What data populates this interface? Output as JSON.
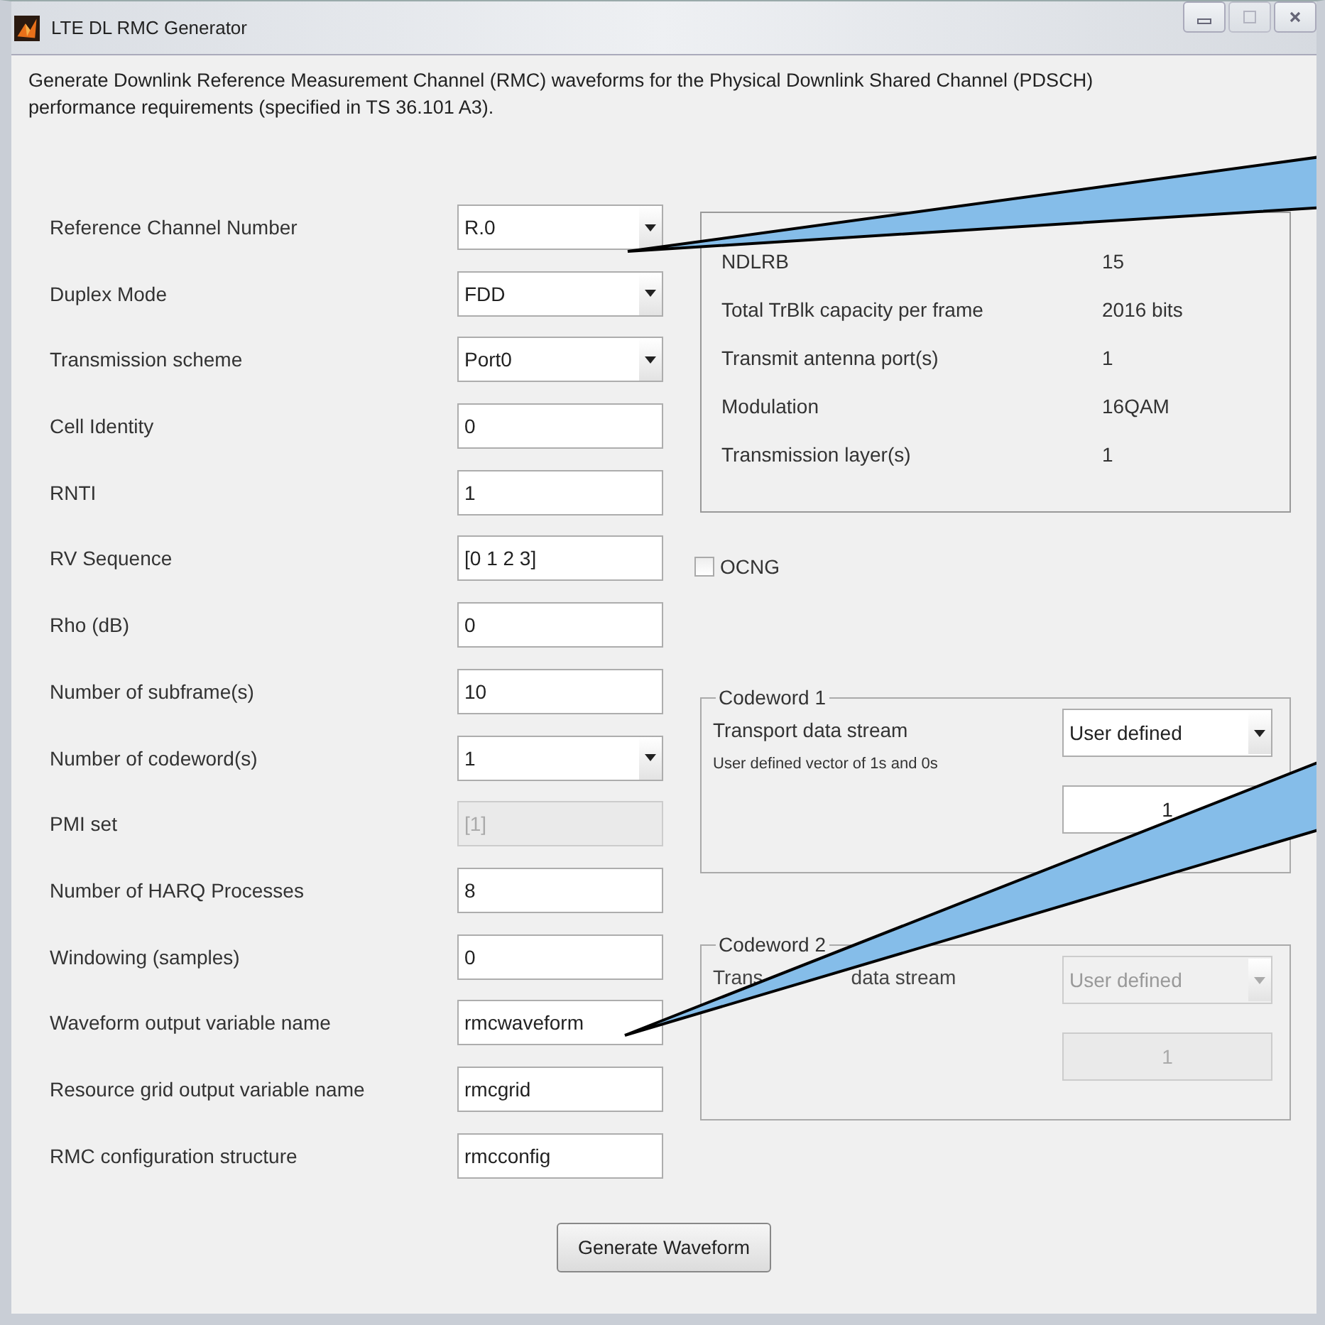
{
  "window": {
    "title": "LTE DL RMC Generator",
    "controls": [
      {
        "kind": "minimize",
        "disabled": false
      },
      {
        "kind": "maximize",
        "disabled": true
      },
      {
        "kind": "close",
        "disabled": false
      }
    ]
  },
  "description": "Generate  Downlink Reference  Measurement Channel (RMC) waveforms for the Physical Downlink Shared Channel (PDSCH) performance requirements (specified in TS 36.101 A3).",
  "fields": [
    {
      "label": "Reference Channel Number",
      "kind": "dropdown",
      "value": "R.0",
      "disabled": false
    },
    {
      "label": "Duplex Mode",
      "kind": "dropdown",
      "value": "FDD",
      "disabled": false
    },
    {
      "label": "Transmission scheme",
      "kind": "dropdown",
      "value": "Port0",
      "disabled": false
    },
    {
      "label": "Cell Identity",
      "kind": "text",
      "value": "0",
      "disabled": false
    },
    {
      "label": "RNTI",
      "kind": "text",
      "value": "1",
      "disabled": false
    },
    {
      "label": "RV Sequence",
      "kind": "text",
      "value": "[0 1 2 3]",
      "disabled": false
    },
    {
      "label": "Rho (dB)",
      "kind": "text",
      "value": "0",
      "disabled": false
    },
    {
      "label": "Number of subframe(s)",
      "kind": "text",
      "value": "10",
      "disabled": false
    },
    {
      "label": "Number of codeword(s)",
      "kind": "dropdown",
      "value": "1",
      "disabled": false
    },
    {
      "label": "PMI set",
      "kind": "text",
      "value": "[1]",
      "disabled": true
    },
    {
      "label": "Number of HARQ Processes",
      "kind": "text",
      "value": "8",
      "disabled": false
    },
    {
      "label": "Windowing (samples)",
      "kind": "text",
      "value": "0",
      "disabled": false
    },
    {
      "label": "Waveform output variable name",
      "kind": "text",
      "value": "rmcwaveform",
      "disabled": false
    },
    {
      "label": " Resource grid output variable name",
      "kind": "text",
      "value": "rmcgrid",
      "disabled": false
    },
    {
      "label": "RMC configuration structure",
      "kind": "text",
      "value": "rmcconfig",
      "disabled": false
    }
  ],
  "parameters": [
    {
      "label": "NDLRB",
      "value": "15"
    },
    {
      "label": "Total TrBlk capacity per frame",
      "value": "2016 bits"
    },
    {
      "label": "Transmit antenna port(s)",
      "value": "1"
    },
    {
      "label": "Modulation",
      "value": "16QAM"
    },
    {
      "label": "Transmission layer(s)",
      "value": "1"
    }
  ],
  "ocng": {
    "label": "OCNG",
    "checked": false
  },
  "codewords": [
    {
      "title": "Codeword 1",
      "stream_label": [
        "Transport data stream"
      ],
      "stream_value": "User defined",
      "hint": "User defined vector of 1s and 0s",
      "vector": "1",
      "disabled": false
    },
    {
      "title": "Codeword 2",
      "stream_label": [
        "Trans",
        "data stream"
      ],
      "stream_value": "User defined",
      "vector": "1",
      "disabled": true
    }
  ],
  "generate_button": "Generate Waveform"
}
